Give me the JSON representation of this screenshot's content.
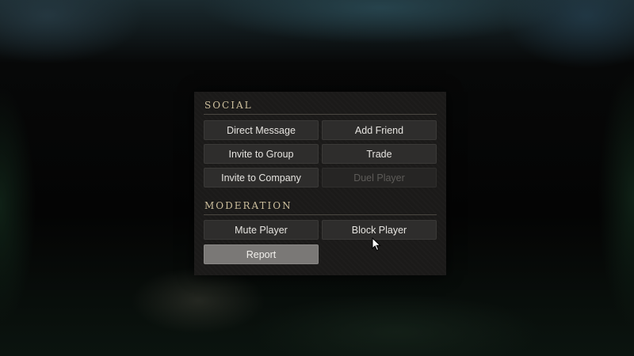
{
  "social": {
    "title": "SOCIAL",
    "buttons": {
      "direct_message": "Direct Message",
      "add_friend": "Add Friend",
      "invite_group": "Invite to Group",
      "trade": "Trade",
      "invite_company": "Invite to Company",
      "duel_player": "Duel Player"
    }
  },
  "moderation": {
    "title": "MODERATION",
    "buttons": {
      "mute_player": "Mute Player",
      "block_player": "Block Player",
      "report": "Report"
    }
  },
  "states": {
    "duel_player": "disabled",
    "report": "highlighted"
  },
  "colors": {
    "panel_bg": "#1b1a19",
    "button_bg": "#2e2d2c",
    "button_highlight": "#7a7876",
    "heading_text": "#cdbf9d",
    "disabled_text": "#5d5b58"
  },
  "cursor": {
    "icon": "pointer-arrow-icon"
  }
}
